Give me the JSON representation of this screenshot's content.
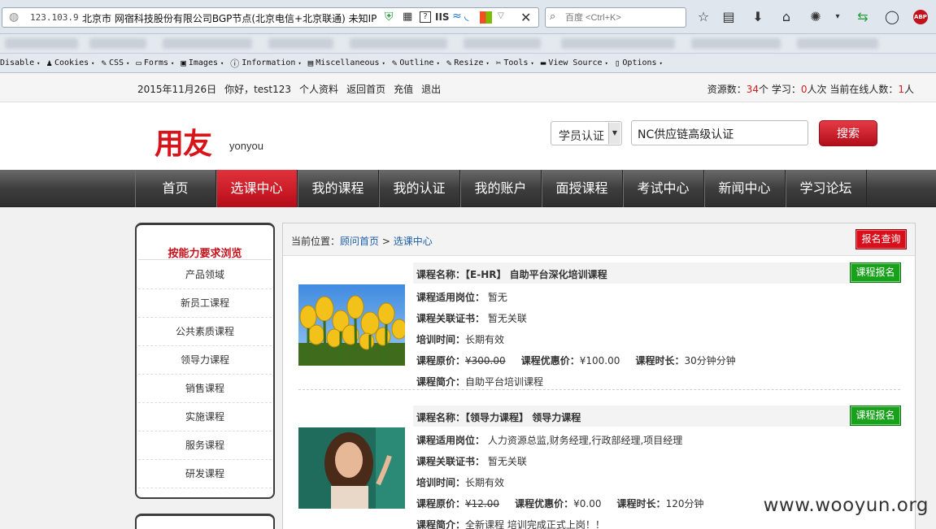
{
  "browser": {
    "url": "123.103.9",
    "site_title": "北京市 网宿科技股份有限公司BGP节点(北京电信+北京联通)  未知IP",
    "search_placeholder": "百度 <Ctrl+K>",
    "dev_toolbar": [
      {
        "icon": "disable-icon",
        "label": "Disable"
      },
      {
        "icon": "cookies-icon",
        "label": "Cookies"
      },
      {
        "icon": "css-icon",
        "label": "CSS"
      },
      {
        "icon": "forms-icon",
        "label": "Forms"
      },
      {
        "icon": "images-icon",
        "label": "Images"
      },
      {
        "icon": "information-icon",
        "label": "Information"
      },
      {
        "icon": "miscellaneous-icon",
        "label": "Miscellaneous"
      },
      {
        "icon": "outline-icon",
        "label": "Outline"
      },
      {
        "icon": "resize-icon",
        "label": "Resize"
      },
      {
        "icon": "tools-icon",
        "label": "Tools"
      },
      {
        "icon": "view-source-icon",
        "label": "View Source"
      },
      {
        "icon": "options-icon",
        "label": "Options"
      }
    ]
  },
  "topbar": {
    "date": "2015年11月26日",
    "greeting": "你好，test123",
    "profile": "个人资料",
    "home": "返回首页",
    "recharge": "充值",
    "logout": "退出",
    "stats_resources_label": "资源数：",
    "stats_resources_value": "34",
    "stats_resources_unit": "个 学习：",
    "stats_study_value": "0",
    "stats_study_unit": "人次 当前在线人数：",
    "stats_online_value": "1",
    "stats_online_unit": "人"
  },
  "header": {
    "logo_cn": "用友",
    "logo_en": "yonyou",
    "search_type": "学员认证",
    "search_value": "NC供应链高级认证",
    "search_button": "搜索"
  },
  "nav": [
    "首页",
    "选课中心",
    "我的课程",
    "我的认证",
    "我的账户",
    "面授课程",
    "考试中心",
    "新闻中心",
    "学习论坛"
  ],
  "nav_active": "选课中心",
  "sidebar": {
    "title": "按能力要求浏览",
    "items": [
      "产品领域",
      "新员工课程",
      "公共素质课程",
      "领导力课程",
      "销售课程",
      "实施课程",
      "服务课程",
      "研发课程"
    ]
  },
  "main": {
    "crumb_prefix": "当前位置：",
    "crumb_home": "顾问首页",
    "crumb_sep": ">",
    "crumb_current": "选课中心",
    "reg_query": "报名查询",
    "labels": {
      "name": "课程名称：",
      "post": "课程适用岗位：",
      "cert": "课程关联证书：",
      "time": "培训时间：",
      "orig": "课程原价：",
      "disc": "课程优惠价：",
      "dur": "课程时长：",
      "intro": "课程简介："
    },
    "enroll": "课程报名",
    "courses": [
      {
        "name": "【E-HR】 自助平台深化培训课程",
        "post": "暂无",
        "cert": "暂无关联",
        "time": "长期有效",
        "orig": "¥300.00",
        "disc": "¥100.00",
        "dur": "30分钟分钟",
        "intro": "自助平台培训课程"
      },
      {
        "name": "【领导力课程】 领导力课程",
        "post": "人力资源总监,财务经理,行政部经理,项目经理",
        "cert": "暂无关联",
        "time": "长期有效",
        "orig": "¥12.00",
        "disc": "¥0.00",
        "dur": "120分钟",
        "intro": "全新课程 培训完成正式上岗！！"
      }
    ]
  },
  "watermark": "www.wooyun.org"
}
